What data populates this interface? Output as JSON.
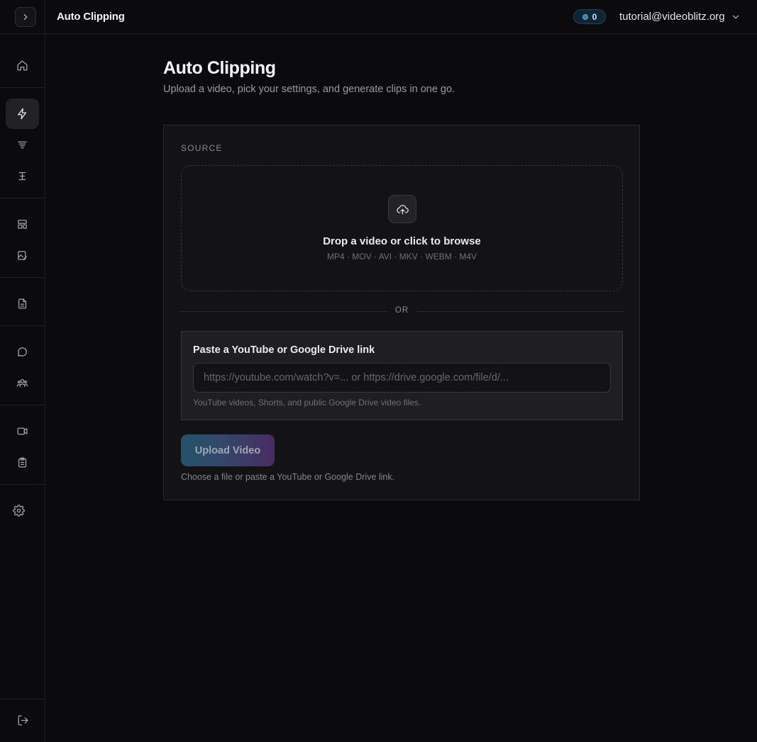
{
  "header": {
    "title": "Auto Clipping",
    "credits": "0",
    "account_email": "tutorial@videoblitz.org"
  },
  "sidebar": {
    "toggle_icon": "chevron-right-icon",
    "items": [
      {
        "icon": "home-icon",
        "active": false
      },
      {
        "icon": "lightning-icon",
        "active": true
      },
      {
        "icon": "filter-lines-icon",
        "active": false
      },
      {
        "icon": "text-cursor-icon",
        "active": false
      },
      {
        "icon": "layout-icon",
        "active": false
      },
      {
        "icon": "image-edit-icon",
        "active": false
      },
      {
        "icon": "document-icon",
        "active": false
      },
      {
        "icon": "chat-bubble-icon",
        "active": false
      },
      {
        "icon": "users-icon",
        "active": false
      },
      {
        "icon": "video-camera-icon",
        "active": false
      },
      {
        "icon": "clipboard-icon",
        "active": false
      },
      {
        "icon": "settings-gear-icon",
        "active": false
      },
      {
        "icon": "logout-icon",
        "active": false
      }
    ]
  },
  "main": {
    "title": "Auto Clipping",
    "subtitle": "Upload a video, pick your settings, and generate clips in one go.",
    "source_label": "SOURCE",
    "dropzone": {
      "title": "Drop a video or click to browse",
      "formats": "MP4 · MOV · AVI · MKV · WEBM · M4V"
    },
    "divider_text": "OR",
    "link": {
      "label": "Paste a YouTube or Google Drive link",
      "placeholder": "https://youtube.com/watch?v=... or https://drive.google.com/file/d/...",
      "value": "",
      "hint": "YouTube videos, Shorts, and public Google Drive video files."
    },
    "upload_button": "Upload Video",
    "upload_hint": "Choose a file or paste a YouTube or Google Drive link."
  },
  "colors": {
    "background": "#0b0b0d",
    "card": "#131316",
    "button_gradient_start": "#24536a",
    "button_gradient_end": "#4a2b63",
    "credit_badge": "#0e2535"
  }
}
